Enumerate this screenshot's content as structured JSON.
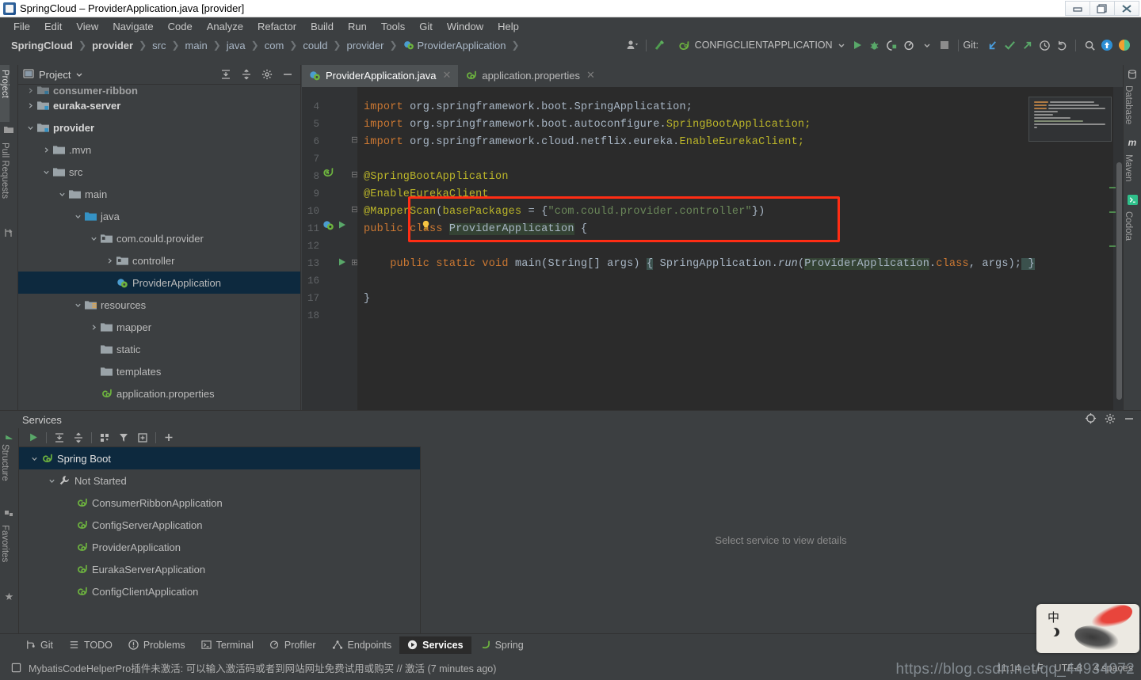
{
  "window": {
    "title": "SpringCloud – ProviderApplication.java [provider]",
    "controls": [
      "minimize",
      "maximize",
      "close"
    ]
  },
  "menubar": {
    "items": [
      "File",
      "Edit",
      "View",
      "Navigate",
      "Code",
      "Analyze",
      "Refactor",
      "Build",
      "Run",
      "Tools",
      "Git",
      "Window",
      "Help"
    ]
  },
  "navbar": {
    "breadcrumbs": [
      {
        "label": "SpringCloud",
        "bold": true
      },
      {
        "label": "provider",
        "bold": true
      },
      {
        "label": "src",
        "bold": false
      },
      {
        "label": "main",
        "bold": false
      },
      {
        "label": "java",
        "bold": false
      },
      {
        "label": "com",
        "bold": false
      },
      {
        "label": "could",
        "bold": false
      },
      {
        "label": "provider",
        "bold": false
      },
      {
        "label": "ProviderApplication",
        "bold": false,
        "icon": "spring-class-icon"
      }
    ],
    "run_config": "CONFIGCLIENTAPPLICATION",
    "git_label": "Git:"
  },
  "left_strip": {
    "items": [
      {
        "label": "Project",
        "active": true
      },
      {
        "label": "Pull Requests",
        "active": false
      }
    ],
    "bottom_items": [
      {
        "label": "Structure"
      },
      {
        "label": "Favorites"
      }
    ]
  },
  "right_strip": {
    "items": [
      {
        "label": "Database"
      },
      {
        "label": "Maven"
      },
      {
        "label": "Codota"
      }
    ]
  },
  "project_panel": {
    "title": "Project",
    "toolbar": [
      "expand-all-icon",
      "collapse-all-icon",
      "gear-icon",
      "hide-icon"
    ],
    "tree": [
      {
        "label": "consumer-ribbon",
        "depth": 1,
        "arrow": "right",
        "icon": "module-icon",
        "bold": true,
        "partial": true
      },
      {
        "label": "euraka-server",
        "depth": 1,
        "arrow": "right",
        "icon": "module-icon",
        "bold": true
      },
      {
        "label": "provider",
        "depth": 1,
        "arrow": "down",
        "icon": "module-icon",
        "bold": true
      },
      {
        "label": ".mvn",
        "depth": 2,
        "arrow": "right",
        "icon": "folder-icon"
      },
      {
        "label": "src",
        "depth": 2,
        "arrow": "down",
        "icon": "folder-icon"
      },
      {
        "label": "main",
        "depth": 3,
        "arrow": "down",
        "icon": "folder-icon"
      },
      {
        "label": "java",
        "depth": 4,
        "arrow": "down",
        "icon": "source-folder-icon"
      },
      {
        "label": "com.could.provider",
        "depth": 5,
        "arrow": "down",
        "icon": "package-icon"
      },
      {
        "label": "controller",
        "depth": 6,
        "arrow": "right",
        "icon": "package-icon"
      },
      {
        "label": "ProviderApplication",
        "depth": 6,
        "arrow": "none",
        "icon": "spring-class-icon",
        "selected": true
      },
      {
        "label": "resources",
        "depth": 4,
        "arrow": "down",
        "icon": "resource-folder-icon"
      },
      {
        "label": "mapper",
        "depth": 5,
        "arrow": "right",
        "icon": "folder-icon"
      },
      {
        "label": "static",
        "depth": 5,
        "arrow": "none",
        "icon": "folder-icon"
      },
      {
        "label": "templates",
        "depth": 5,
        "arrow": "none",
        "icon": "folder-icon"
      },
      {
        "label": "application.properties",
        "depth": 5,
        "arrow": "none",
        "icon": "spring-config-icon"
      }
    ]
  },
  "editor": {
    "tabs": [
      {
        "label": "ProviderApplication.java",
        "icon": "spring-class-icon",
        "active": true
      },
      {
        "label": "application.properties",
        "icon": "spring-config-icon",
        "active": false
      }
    ],
    "lines": [
      {
        "num": "4",
        "tokens": [
          {
            "t": "import ",
            "c": "k"
          },
          {
            "t": "org.springframework.boot.SpringApplication;",
            "c": "pl"
          }
        ]
      },
      {
        "num": "5",
        "tokens": [
          {
            "t": "import ",
            "c": "k"
          },
          {
            "t": "org.springframework.boot.autoconfigure.",
            "c": "pl"
          },
          {
            "t": "SpringBootApplication;",
            "c": "an"
          }
        ]
      },
      {
        "num": "6",
        "tokens": [
          {
            "t": "import ",
            "c": "k"
          },
          {
            "t": "org.springframework.cloud.netflix.eureka.",
            "c": "pl"
          },
          {
            "t": "EnableEurekaClient;",
            "c": "an"
          }
        ]
      },
      {
        "num": "7",
        "tokens": []
      },
      {
        "num": "8",
        "tokens": [
          {
            "t": "@SpringBootApplication",
            "c": "an"
          }
        ]
      },
      {
        "num": "9",
        "tokens": [
          {
            "t": "@EnableEurekaClient",
            "c": "an"
          }
        ]
      },
      {
        "num": "10",
        "tokens": [
          {
            "t": "@MapperScan",
            "c": "an"
          },
          {
            "t": "(",
            "c": "pl"
          },
          {
            "t": "basePackages",
            "c": "an"
          },
          {
            "t": " = {",
            "c": "pl"
          },
          {
            "t": "\"com.could.provider.controller\"",
            "c": "st"
          },
          {
            "t": "})",
            "c": "pl"
          }
        ]
      },
      {
        "num": "11",
        "tokens": [
          {
            "t": "public class ",
            "c": "k"
          },
          {
            "t": "ProviderApplication",
            "c": "pl hl"
          },
          {
            "t": " {",
            "c": "pl"
          }
        ]
      },
      {
        "num": "12",
        "tokens": []
      },
      {
        "num": "13",
        "tokens": [
          {
            "t": "    public static void ",
            "c": "k"
          },
          {
            "t": "main",
            "c": "pl"
          },
          {
            "t": "(",
            "c": "pl"
          },
          {
            "t": "String",
            "c": "pl"
          },
          {
            "t": "[] args) ",
            "c": "pl"
          },
          {
            "t": "{",
            "c": "pl brhl"
          },
          {
            "t": " SpringApplication.",
            "c": "pl"
          },
          {
            "t": "run",
            "c": "it"
          },
          {
            "t": "(",
            "c": "pl"
          },
          {
            "t": "ProviderApplication",
            "c": "pl hl"
          },
          {
            "t": ".",
            "c": "pl"
          },
          {
            "t": "class",
            "c": "k"
          },
          {
            "t": ", args);",
            "c": "pl"
          },
          {
            "t": " }",
            "c": "pl brhl"
          }
        ]
      },
      {
        "num": "16",
        "tokens": []
      },
      {
        "num": "17",
        "tokens": [
          {
            "t": "}",
            "c": "pl"
          }
        ]
      },
      {
        "num": "18",
        "tokens": []
      }
    ],
    "annotation": {
      "type": "red-rectangle",
      "covers_lines": [
        "9",
        "10"
      ]
    },
    "inspection_status": "ok-checkmark"
  },
  "services_panel": {
    "title": "Services",
    "header_buttons": [
      "locate-icon",
      "gear-icon",
      "hide-icon"
    ],
    "toolbar": [
      "run-icon",
      "expand-all-icon",
      "collapse-all-icon",
      "group-icon",
      "filter-icon",
      "layout-icon",
      "add-icon"
    ],
    "left_tools": [
      "run-icon",
      "debug-icon",
      "stop-icon"
    ],
    "tree": [
      {
        "label": "Spring Boot",
        "depth": 1,
        "arrow": "down",
        "icon": "spring-icon",
        "selected": true
      },
      {
        "label": "Not Started",
        "depth": 2,
        "arrow": "down",
        "icon": "wrench-icon"
      },
      {
        "label": "ConsumerRibbonApplication",
        "depth": 3,
        "arrow": "none",
        "icon": "spring-icon"
      },
      {
        "label": "ConfigServerApplication",
        "depth": 3,
        "arrow": "none",
        "icon": "spring-icon"
      },
      {
        "label": "ProviderApplication",
        "depth": 3,
        "arrow": "none",
        "icon": "spring-icon"
      },
      {
        "label": "EurakaServerApplication",
        "depth": 3,
        "arrow": "none",
        "icon": "spring-icon"
      },
      {
        "label": "ConfigClientApplication",
        "depth": 3,
        "arrow": "none",
        "icon": "spring-icon"
      }
    ],
    "detail_placeholder": "Select service to view details"
  },
  "bottom_bar": {
    "tabs": [
      {
        "label": "Git",
        "icon": "git-icon",
        "active": false
      },
      {
        "label": "TODO",
        "icon": "todo-icon",
        "active": false
      },
      {
        "label": "Problems",
        "icon": "problems-icon",
        "active": false
      },
      {
        "label": "Terminal",
        "icon": "terminal-icon",
        "active": false
      },
      {
        "label": "Profiler",
        "icon": "profiler-icon",
        "active": false
      },
      {
        "label": "Endpoints",
        "icon": "endpoints-icon",
        "active": false
      },
      {
        "label": "Services",
        "icon": "services-icon",
        "active": true
      },
      {
        "label": "Spring",
        "icon": "spring-icon",
        "active": false
      }
    ]
  },
  "status_bar": {
    "message": "MybatisCodeHelperPro插件未激活: 可以输入激活码或者到网站网址免费试用或购买 // 激活 (7 minutes ago)",
    "message_icon": "notification-icon",
    "caret_position": "11:14",
    "line_separator": "LF",
    "encoding": "UTF-8",
    "indent": "4 spaces"
  },
  "overlay": {
    "watermark": "https://blog.csdn.net/qq_44934072",
    "ime_indicator": "中"
  },
  "colors": {
    "bg_panel": "#3c3f41",
    "bg_editor": "#2b2b2b",
    "selection": "#0d293e",
    "accent_red": "#ff2d14",
    "keyword": "#cc7832",
    "annotation": "#bbb529",
    "string": "#6a8759",
    "plain": "#a9b7c6",
    "green": "#499c54"
  }
}
